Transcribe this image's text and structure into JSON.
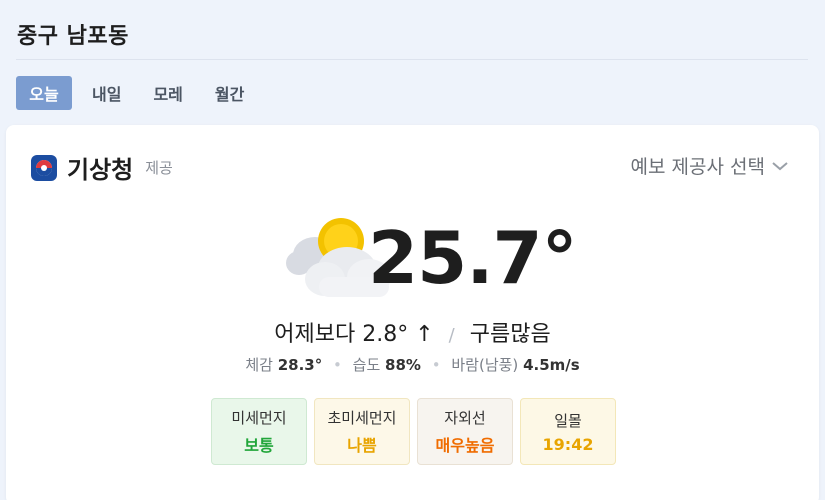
{
  "header": {
    "location": "중구 남포동"
  },
  "tabs": [
    {
      "label": "오늘",
      "active": true
    },
    {
      "label": "내일",
      "active": false
    },
    {
      "label": "모레",
      "active": false
    },
    {
      "label": "월간",
      "active": false
    }
  ],
  "provider": {
    "name": "기상청",
    "tag": "제공",
    "select_label": "예보 제공사 선택",
    "logo_icon": "kma-logo-icon"
  },
  "current": {
    "temperature": "25.7°",
    "icon": "partly-cloudy-icon",
    "compare_label": "어제보다",
    "compare_value": "2.8° ↑",
    "condition": "구름많음"
  },
  "details": {
    "feels_label": "체감",
    "feels_value": "28.3°",
    "humidity_label": "습도",
    "humidity_value": "88%",
    "wind_label": "바람(남풍)",
    "wind_value": "4.5m/s"
  },
  "badges": [
    {
      "label": "미세먼지",
      "value": "보통",
      "color": "#21a63a"
    },
    {
      "label": "초미세먼지",
      "value": "나쁨",
      "color": "#e8a400"
    },
    {
      "label": "자외선",
      "value": "매우높음",
      "color": "#f06c00"
    },
    {
      "label": "일몰",
      "value": "19:42",
      "color": "#e8a400"
    }
  ],
  "colors": {
    "background": "#eef3fb",
    "active_tab": "#7b9cd0",
    "logo": "#1c4da1"
  }
}
